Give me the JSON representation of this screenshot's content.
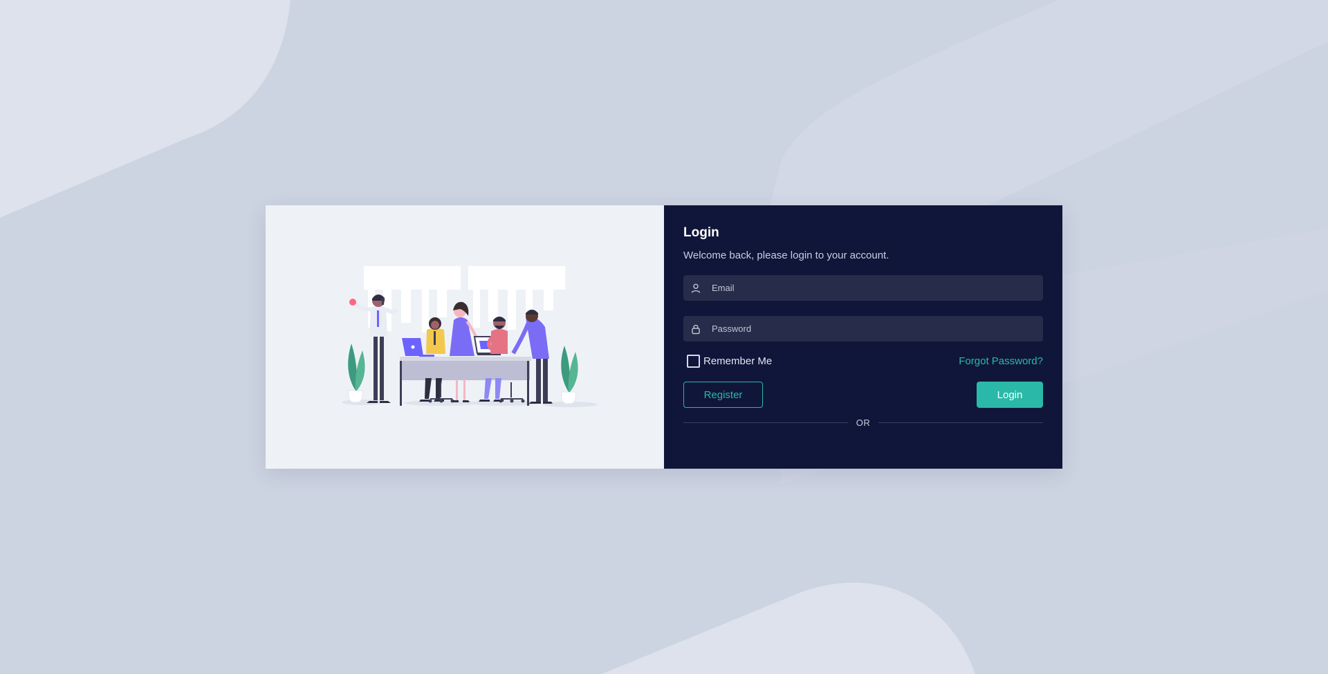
{
  "form": {
    "title": "Login",
    "subtitle": "Welcome back, please login to your account.",
    "email_placeholder": "Email",
    "password_placeholder": "Password",
    "remember_label": "Remember Me",
    "forgot_label": "Forgot Password?",
    "register_label": "Register",
    "login_label": "Login",
    "divider_text": "OR"
  },
  "icons": {
    "email_field": "user-icon",
    "password_field": "lock-icon"
  },
  "colors": {
    "page_background": "#ccd3e1",
    "illustration_panel": "#eef2f7",
    "form_panel": "#10163a",
    "input_background": "#262c49",
    "accent": "#2ab9a8"
  }
}
